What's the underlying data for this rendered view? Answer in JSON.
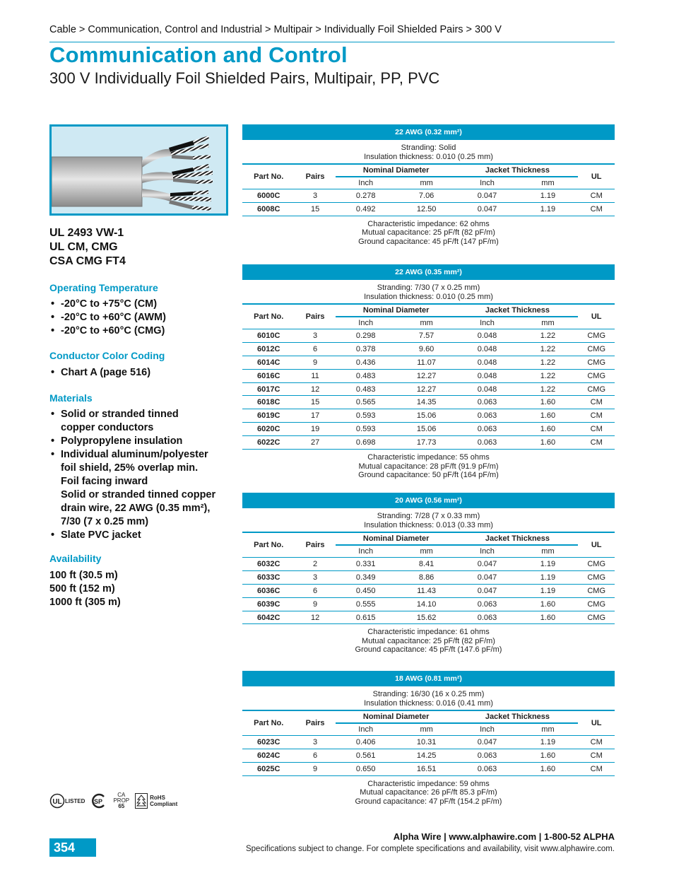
{
  "breadcrumb": "Cable > Communication, Control and Industrial > Multipair > Individually Foil Shielded Pairs > 300 V",
  "title": "Communication and Control",
  "subtitle": "300 V Individually Foil Shielded Pairs, Multipair, PP, PVC",
  "certifications": [
    "UL 2493 VW-1",
    "UL CM, CMG",
    "CSA CMG FT4"
  ],
  "operating_temperature": {
    "heading": "Operating Temperature",
    "items": [
      "-20°C to +75°C (CM)",
      "-20°C to +60°C (AWM)",
      "-20°C to +60°C (CMG)"
    ]
  },
  "color_coding": {
    "heading": "Conductor Color Coding",
    "items": [
      "Chart A (page 516)"
    ]
  },
  "materials": {
    "heading": "Materials",
    "items": [
      {
        "bullet": true,
        "text": "Solid or stranded tinned"
      },
      {
        "bullet": false,
        "text": "copper conductors"
      },
      {
        "bullet": true,
        "text": "Polypropylene insulation"
      },
      {
        "bullet": true,
        "text": "Individual aluminum/polyester"
      },
      {
        "bullet": false,
        "text": "foil shield, 25% overlap min."
      },
      {
        "bullet": false,
        "text": "Foil facing inward"
      },
      {
        "bullet": false,
        "text": "Solid or stranded tinned copper"
      },
      {
        "bullet": false,
        "text": "drain wire, 22 AWG (0.35 mm²),"
      },
      {
        "bullet": false,
        "text": "7/30 (7 x 0.25 mm)"
      },
      {
        "bullet": true,
        "text": "Slate PVC jacket"
      }
    ]
  },
  "availability": {
    "heading": "Availability",
    "items": [
      "100 ft (30.5 m)",
      "500 ft (152 m)",
      "1000 ft (305 m)"
    ]
  },
  "table_headers": {
    "part_no": "Part No.",
    "pairs": "Pairs",
    "nominal_diameter": "Nominal Diameter",
    "jacket_thickness": "Jacket Thickness",
    "ul": "UL",
    "inch": "Inch",
    "mm": "mm"
  },
  "tables": [
    {
      "title": "22 AWG (0.32 mm²)",
      "stranding": "Stranding: Solid",
      "insulation": "Insulation thickness: 0.010 (0.25 mm)",
      "rows": [
        [
          "6000C",
          "3",
          "0.278",
          "7.06",
          "0.047",
          "1.19",
          "CM"
        ],
        [
          "6008C",
          "15",
          "0.492",
          "12.50",
          "0.047",
          "1.19",
          "CM"
        ]
      ],
      "notes": [
        "Characteristic impedance: 62 ohms",
        "Mutual capacitance: 25 pF/ft (82 pF/m)",
        "Ground capacitance: 45 pF/ft (147 pF/m)"
      ]
    },
    {
      "title": "22 AWG (0.35 mm²)",
      "stranding": "Stranding: 7/30 (7 x 0.25 mm)",
      "insulation": "Insulation thickness: 0.010 (0.25 mm)",
      "rows": [
        [
          "6010C",
          "3",
          "0.298",
          "7.57",
          "0.048",
          "1.22",
          "CMG"
        ],
        [
          "6012C",
          "6",
          "0.378",
          "9.60",
          "0.048",
          "1.22",
          "CMG"
        ],
        [
          "6014C",
          "9",
          "0.436",
          "11.07",
          "0.048",
          "1.22",
          "CMG"
        ],
        [
          "6016C",
          "11",
          "0.483",
          "12.27",
          "0.048",
          "1.22",
          "CMG"
        ],
        [
          "6017C",
          "12",
          "0.483",
          "12.27",
          "0.048",
          "1.22",
          "CMG"
        ],
        [
          "6018C",
          "15",
          "0.565",
          "14.35",
          "0.063",
          "1.60",
          "CM"
        ],
        [
          "6019C",
          "17",
          "0.593",
          "15.06",
          "0.063",
          "1.60",
          "CM"
        ],
        [
          "6020C",
          "19",
          "0.593",
          "15.06",
          "0.063",
          "1.60",
          "CM"
        ],
        [
          "6022C",
          "27",
          "0.698",
          "17.73",
          "0.063",
          "1.60",
          "CM"
        ]
      ],
      "notes": [
        "Characteristic impedance: 55 ohms",
        "Mutual capacitance: 28 pF/ft (91.9 pF/m)",
        "Ground capacitance: 50 pF/ft (164 pF/m)"
      ]
    },
    {
      "title": "20 AWG (0.56 mm²)",
      "stranding": "Stranding: 7/28 (7 x 0.33 mm)",
      "insulation": "Insulation thickness: 0.013 (0.33 mm)",
      "rows": [
        [
          "6032C",
          "2",
          "0.331",
          "8.41",
          "0.047",
          "1.19",
          "CMG"
        ],
        [
          "6033C",
          "3",
          "0.349",
          "8.86",
          "0.047",
          "1.19",
          "CMG"
        ],
        [
          "6036C",
          "6",
          "0.450",
          "11.43",
          "0.047",
          "1.19",
          "CMG"
        ],
        [
          "6039C",
          "9",
          "0.555",
          "14.10",
          "0.063",
          "1.60",
          "CMG"
        ],
        [
          "6042C",
          "12",
          "0.615",
          "15.62",
          "0.063",
          "1.60",
          "CMG"
        ]
      ],
      "notes": [
        "Characteristic impedance: 61 ohms",
        "Mutual capacitance: 25 pF/ft (82 pF/m)",
        "Ground capacitance: 45 pF/ft (147.6 pF/m)"
      ]
    },
    {
      "title": "18 AWG (0.81 mm²)",
      "stranding": "Stranding: 16/30 (16 x 0.25 mm)",
      "insulation": "Insulation thickness: 0.016 (0.41 mm)",
      "rows": [
        [
          "6023C",
          "3",
          "0.406",
          "10.31",
          "0.047",
          "1.19",
          "CM"
        ],
        [
          "6024C",
          "6",
          "0.561",
          "14.25",
          "0.063",
          "1.60",
          "CM"
        ],
        [
          "6025C",
          "9",
          "0.650",
          "16.51",
          "0.063",
          "1.60",
          "CM"
        ]
      ],
      "notes": [
        "Characteristic impedance: 59 ohms",
        "Mutual capacitance: 26 pF/ft 85.3 pF/m)",
        "Ground capacitance: 47 pF/ft (154.2 pF/m)"
      ]
    }
  ],
  "logos": {
    "ul": "UL",
    "ul_listed": "LISTED",
    "csa": "SP",
    "prop65": [
      "CA",
      "PROP",
      "65"
    ],
    "rohs": [
      "RoHS",
      "Compliant"
    ]
  },
  "footer": {
    "page_number": "354",
    "brand_line": "Alpha Wire | www.alphawire.com | 1-800-52 ALPHA",
    "note": "Specifications subject to change. For complete specifications and availability, visit www.alphawire.com."
  },
  "colors": {
    "accent": "#0099c6",
    "image_bg": "#cfe9f3"
  }
}
